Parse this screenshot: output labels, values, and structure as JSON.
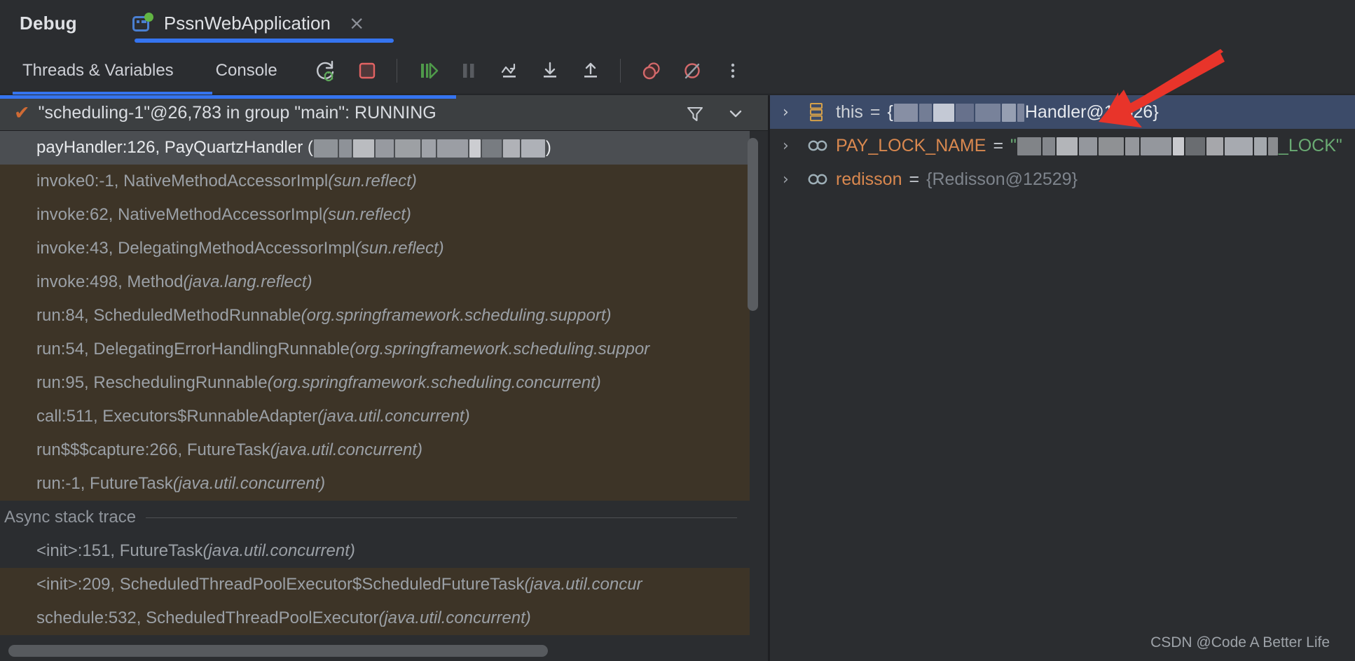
{
  "window": {
    "debug_label": "Debug",
    "watermark": "CSDN @Code A Better Life"
  },
  "tabs": {
    "run_config_name": "PssnWebApplication",
    "close_label": "×",
    "run_icon": "run-configuration-icon",
    "status_dot": "running-indicator"
  },
  "toolbar": {
    "tabs": [
      {
        "label": "Threads & Variables",
        "selected": true
      },
      {
        "label": "Console",
        "selected": false
      }
    ],
    "buttons": [
      {
        "name": "rerun-debug-button",
        "tooltip": "Rerun"
      },
      {
        "name": "stop-button",
        "tooltip": "Stop"
      },
      {
        "name": "resume-program-button",
        "tooltip": "Resume Program"
      },
      {
        "name": "pause-program-button",
        "tooltip": "Pause Program"
      },
      {
        "name": "step-over-button",
        "tooltip": "Step Over"
      },
      {
        "name": "step-into-button",
        "tooltip": "Step Into"
      },
      {
        "name": "step-out-button",
        "tooltip": "Step Out"
      },
      {
        "name": "view-breakpoints-button",
        "tooltip": "View Breakpoints"
      },
      {
        "name": "mute-breakpoints-button",
        "tooltip": "Mute Breakpoints"
      },
      {
        "name": "more-options-button",
        "tooltip": "More"
      }
    ]
  },
  "frames_panel": {
    "thread_status": "\"scheduling-1\"@26,783 in group \"main\": RUNNING",
    "thread_state_icon": "checkmark-icon",
    "filter_icon": "filter-icon",
    "chevron_icon": "chevron-down-icon",
    "async_separator_label": "Async stack trace",
    "frames": [
      {
        "method": "payHandler:126, PayQuartzHandler (",
        "package": "",
        "suffix": ")",
        "style": "selected",
        "redacted": true,
        "redaction_width": 330
      },
      {
        "method": "invoke0:-1, NativeMethodAccessorImpl ",
        "package": "(sun.reflect)",
        "style": "lib"
      },
      {
        "method": "invoke:62, NativeMethodAccessorImpl ",
        "package": "(sun.reflect)",
        "style": "lib"
      },
      {
        "method": "invoke:43, DelegatingMethodAccessorImpl ",
        "package": "(sun.reflect)",
        "style": "lib"
      },
      {
        "method": "invoke:498, Method ",
        "package": "(java.lang.reflect)",
        "style": "lib"
      },
      {
        "method": "run:84, ScheduledMethodRunnable ",
        "package": "(org.springframework.scheduling.support)",
        "style": "lib"
      },
      {
        "method": "run:54, DelegatingErrorHandlingRunnable ",
        "package": "(org.springframework.scheduling.suppor",
        "style": "lib"
      },
      {
        "method": "run:95, ReschedulingRunnable ",
        "package": "(org.springframework.scheduling.concurrent)",
        "style": "lib"
      },
      {
        "method": "call:511, Executors$RunnableAdapter ",
        "package": "(java.util.concurrent)",
        "style": "lib"
      },
      {
        "method": "run$$$capture:266, FutureTask ",
        "package": "(java.util.concurrent)",
        "style": "lib"
      },
      {
        "method": "run:-1, FutureTask ",
        "package": "(java.util.concurrent)",
        "style": "lib"
      }
    ],
    "async_frames": [
      {
        "method": "<init>:151, FutureTask ",
        "package": "(java.util.concurrent)",
        "style": "plain"
      },
      {
        "method": "<init>:209, ScheduledThreadPoolExecutor$ScheduledFutureTask ",
        "package": "(java.util.concur",
        "style": "lib"
      },
      {
        "method": "schedule:532, ScheduledThreadPoolExecutor ",
        "package": "(java.util.concurrent)",
        "style": "lib"
      }
    ]
  },
  "variables_panel": {
    "rows": [
      {
        "chevron": "›",
        "icon": "object-value-icon",
        "name": "this",
        "name_kind": "keyword",
        "equals": "=",
        "value_prefix": "{",
        "value_redacted": true,
        "value_suffix": "Handler@17626}",
        "value_kind": "object",
        "selected": true
      },
      {
        "chevron": "›",
        "icon": "static-field-icon",
        "name": "PAY_LOCK_NAME",
        "name_kind": "field",
        "equals": "=",
        "value_prefix": "\"",
        "value_redacted": true,
        "value_suffix": "_LOCK\"",
        "value_kind": "string",
        "selected": false
      },
      {
        "chevron": "›",
        "icon": "static-field-icon",
        "name": "redisson",
        "name_kind": "field",
        "equals": "=",
        "value_prefix": "",
        "value_redacted": false,
        "value_suffix": "{Redisson@12529}",
        "value_kind": "plain",
        "selected": false
      }
    ]
  },
  "annotation": {
    "arrow": "red-arrow-pointing-to-this-variable",
    "color": "#e8342a"
  },
  "colors": {
    "accent_blue": "#3574f0",
    "selection_blue": "#3c4b69",
    "library_frame_bg": "#3d3427",
    "panel_bg": "#2b2d30",
    "field_orange": "#d9884f",
    "string_green": "#6aab73",
    "arrow_red": "#e8342a",
    "run_green": "#62b543",
    "stop_red": "#e36363"
  }
}
